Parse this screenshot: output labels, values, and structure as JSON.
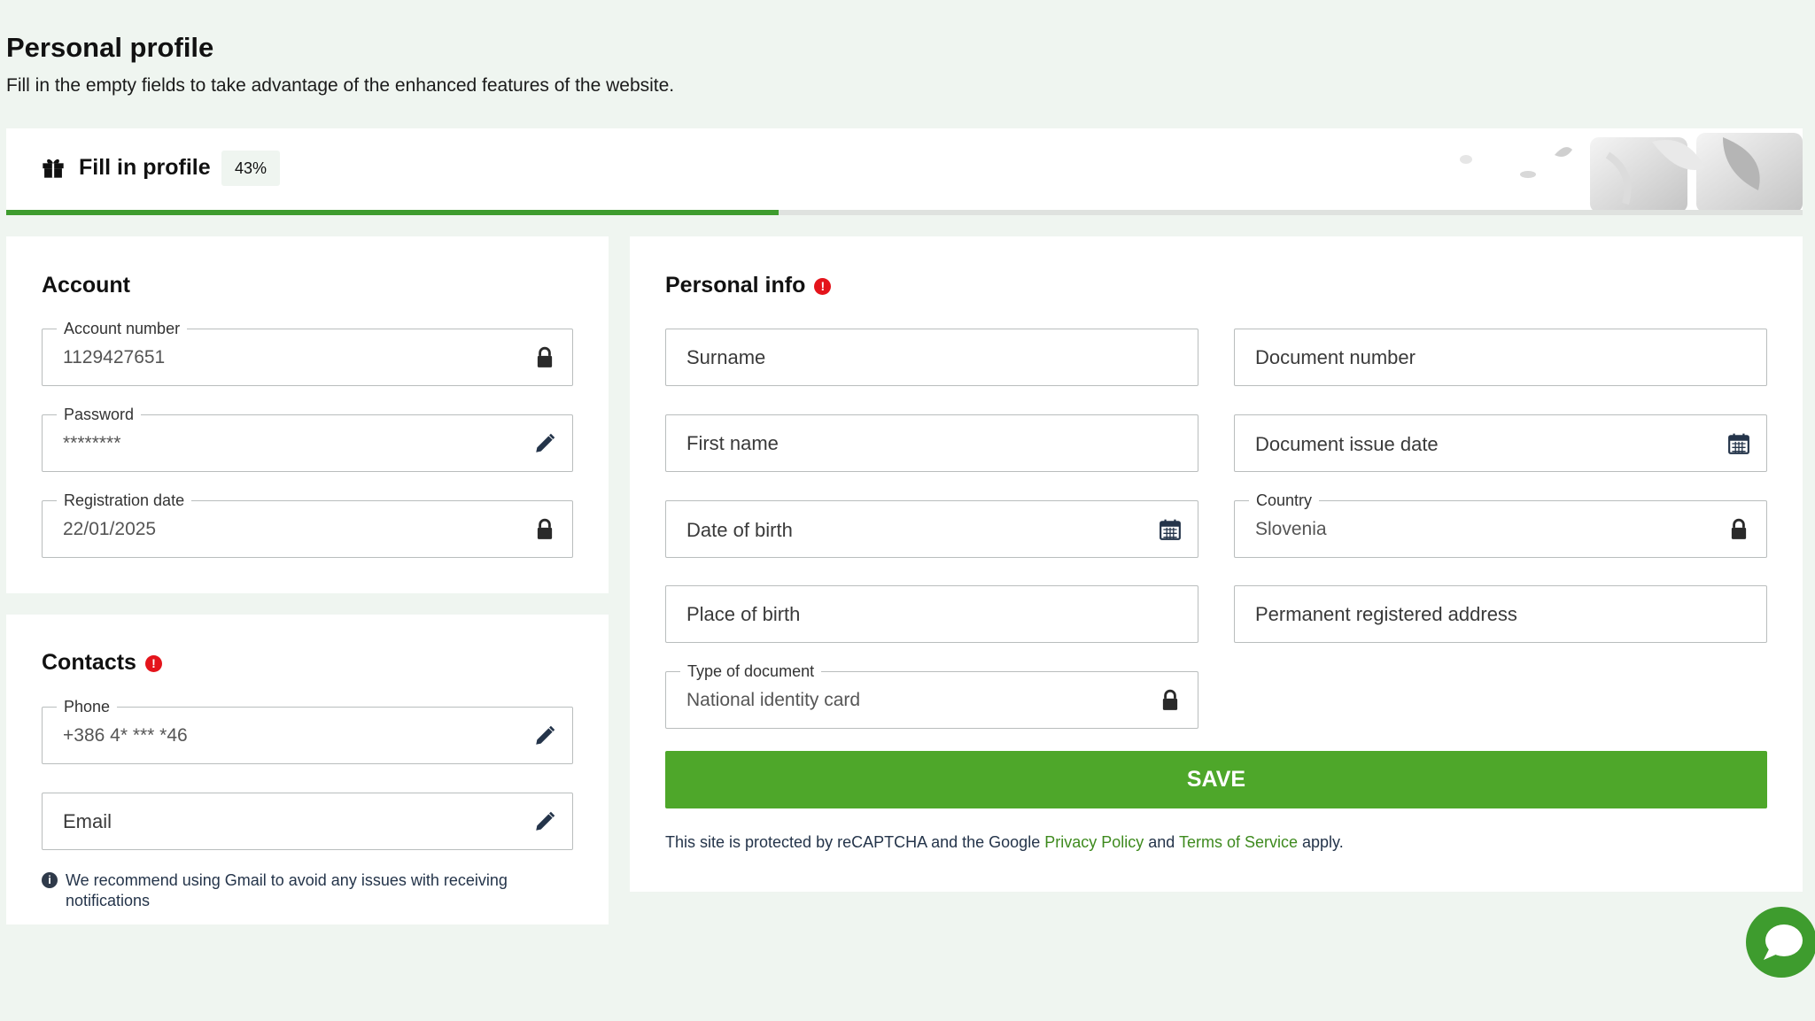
{
  "header": {
    "title": "Personal profile",
    "subtitle": "Fill in the empty fields to take advantage of the enhanced features of the website."
  },
  "progress": {
    "label": "Fill in profile",
    "percent_text": "43%",
    "value": 0.43,
    "icon": "gift-icon",
    "color": "#3e9c2e"
  },
  "account": {
    "title": "Account",
    "fields": [
      {
        "label": "Account number",
        "value": "1129427651",
        "icon": "lock-icon"
      },
      {
        "label": "Password",
        "value": "********",
        "icon": "pencil-icon"
      },
      {
        "label": "Registration date",
        "value": "22/01/2025",
        "icon": "lock-icon"
      }
    ]
  },
  "contacts": {
    "title": "Contacts",
    "alert": "!",
    "phone": {
      "label": "Phone",
      "value": "+386 4* *** *46",
      "icon": "pencil-icon"
    },
    "email": {
      "placeholder": "Email",
      "icon": "pencil-icon"
    },
    "note": "We recommend using Gmail to avoid any issues with receiving notifications"
  },
  "personal_info": {
    "title": "Personal info",
    "alert": "!",
    "surname": "Surname",
    "first_name": "First name",
    "date_of_birth": "Date of birth",
    "place_of_birth": "Place of birth",
    "document_type": {
      "label": "Type of document",
      "value": "National identity card"
    },
    "document_number": "Document number",
    "document_issue_date": "Document issue date",
    "country": {
      "label": "Country",
      "value": "Slovenia"
    },
    "permanent_address": "Permanent registered address",
    "save_label": "SAVE"
  },
  "recaptcha": {
    "prefix": "This site is protected by reCAPTCHA and the Google ",
    "privacy_link": "Privacy Policy",
    "and": " and ",
    "terms_link": "Terms of Service",
    "suffix": " apply."
  },
  "colors": {
    "accent": "#4ea72a",
    "alert": "#e4141b",
    "background": "#eff5f0"
  }
}
